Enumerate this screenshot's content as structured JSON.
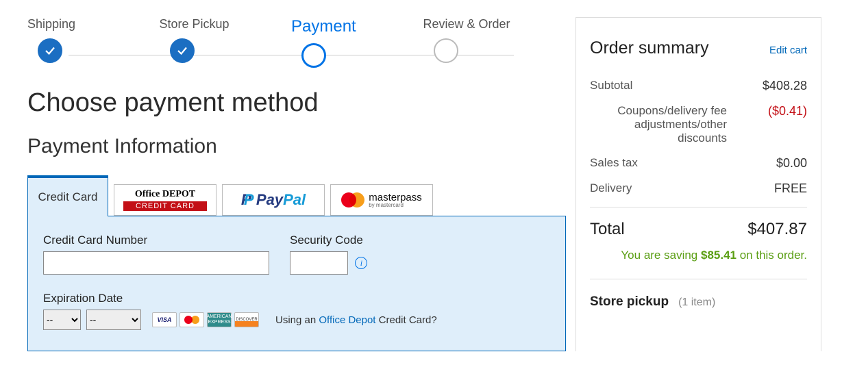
{
  "stepper": {
    "steps": [
      {
        "label": "Shipping"
      },
      {
        "label": "Store Pickup"
      },
      {
        "label": "Payment"
      },
      {
        "label": "Review & Order"
      }
    ]
  },
  "heading": "Choose payment method",
  "subheading": "Payment Information",
  "tabs": {
    "credit_card": "Credit Card",
    "od_name": "Office DEPOT",
    "od_strip": "CREDIT CARD",
    "paypal_pay": "Pay",
    "paypal_pal": "Pal",
    "masterpass": "masterpass",
    "masterpass_sub": "by mastercard"
  },
  "cc": {
    "number_label": "Credit Card Number",
    "code_label": "Security Code",
    "exp_label": "Expiration Date",
    "month_default": "--",
    "year_default": "--",
    "using_prefix": "Using an ",
    "using_link": "Office Depot",
    "using_suffix": " Credit Card?",
    "visa": "VISA",
    "amex": "AMERICAN EXPRESS",
    "disc": "DISCOVER"
  },
  "summary": {
    "title": "Order summary",
    "edit": "Edit cart",
    "subtotal_lbl": "Subtotal",
    "subtotal_val": "$408.28",
    "discount_lbl": "Coupons/delivery fee adjustments/other discounts",
    "discount_val": "($0.41)",
    "tax_lbl": "Sales tax",
    "tax_val": "$0.00",
    "delivery_lbl": "Delivery",
    "delivery_val": "FREE",
    "total_lbl": "Total",
    "total_val": "$407.87",
    "savings_prefix": "You are saving ",
    "savings_amount": "$85.41",
    "savings_suffix": " on this order.",
    "pickup_title": "Store pickup",
    "pickup_count": "(1 item)"
  }
}
